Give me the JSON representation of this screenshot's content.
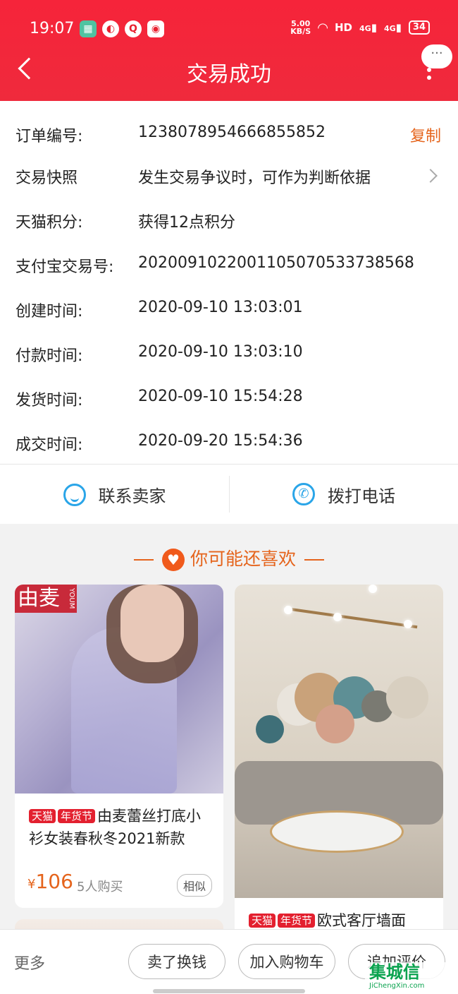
{
  "status_bar": {
    "time": "19:07",
    "net_speed": "5.00",
    "net_unit": "KB/S",
    "hd": "HD",
    "sig1": "4G",
    "sig2": "4G",
    "battery": "34"
  },
  "header": {
    "title": "交易成功",
    "bubble": "···"
  },
  "order_info": {
    "order_no_label": "订单编号:",
    "order_no": "1238078954666855852",
    "copy_label": "复制",
    "snapshot_label": "交易快照",
    "snapshot_value": "发生交易争议时，可作为判断依据",
    "points_label": "天猫积分:",
    "points_value": "获得12点积分",
    "alipay_label": "支付宝交易号:",
    "alipay_value": "2020091022001105070533738568",
    "created_label": "创建时间:",
    "created_value": "2020-09-10 13:03:01",
    "paid_label": "付款时间:",
    "paid_value": "2020-09-10 13:03:10",
    "shipped_label": "发货时间:",
    "shipped_value": "2020-09-10 15:54:28",
    "done_label": "成交时间:",
    "done_value": "2020-09-20 15:54:36"
  },
  "actions": {
    "contact_seller": "联系卖家",
    "call_phone": "拨打电话"
  },
  "recommend": {
    "title": "你可能还喜欢",
    "items": [
      {
        "brand": "由麦",
        "brand_side": "YOUM",
        "badges": [
          "天猫",
          "年货节"
        ],
        "title": "由麦蕾丝打底小衫女装春秋冬2021新款",
        "currency": "¥",
        "price": "106",
        "buyers": "5人购买",
        "similar": "相似"
      },
      {
        "badges": [
          "天猫",
          "年货节"
        ],
        "title": "欧式客厅墙面"
      }
    ]
  },
  "bottom_bar": {
    "more": "更多",
    "sell": "卖了换钱",
    "add_cart": "加入购物车",
    "add_review": "追加评价"
  },
  "watermark": {
    "text": "集城信",
    "sub": "JiChengXin.com"
  },
  "colors": {
    "brand_red": "#f6243a",
    "accent_orange": "#e5641c",
    "icon_blue": "#2aa5e8"
  }
}
